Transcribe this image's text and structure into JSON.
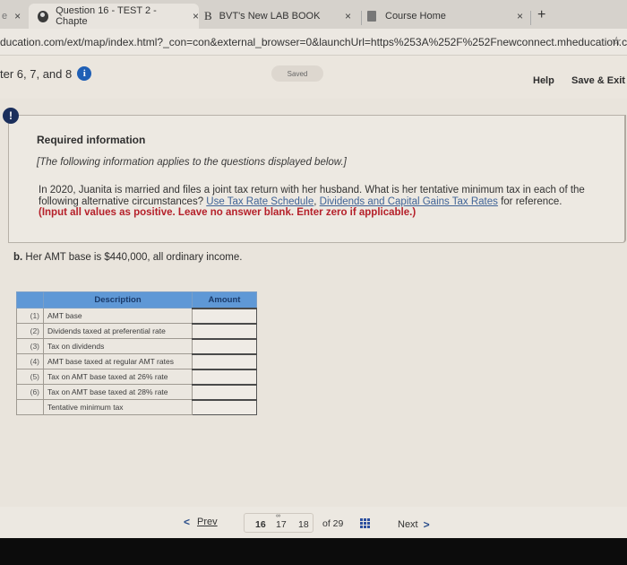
{
  "browser": {
    "tabs": [
      {
        "label": "e",
        "active": false
      },
      {
        "label": "Question 16 - TEST 2 - Chapte",
        "active": true
      },
      {
        "label": "BVT's New LAB BOOK",
        "icon_letter": "B",
        "active": false
      },
      {
        "label": "Course Home",
        "active": false
      }
    ],
    "new_tab": "+",
    "close_glyph": "×",
    "url": "ducation.com/ext/map/index.html?_con=con&external_browser=0&launchUrl=https%253A%252F%252Fnewconnect.mheducation.co...",
    "star": "☆"
  },
  "header": {
    "chapter": "ter 6, 7, and 8",
    "info_glyph": "i",
    "saved": "Saved",
    "help": "Help",
    "save_exit": "Save & Exit"
  },
  "info": {
    "alert_glyph": "!",
    "title": "Required information",
    "subtitle": "[The following information applies to the questions displayed below.]",
    "body_1": "In 2020, Juanita is married and files a joint tax return with her husband. What is her tentative minimum tax in each of the following alternative circumstances? ",
    "link_1": "Use Tax Rate Schedule",
    "sep": ", ",
    "link_2": "Dividends and Capital Gains Tax Rates",
    "body_2": " for reference.",
    "note": "(Input all values as positive. Leave no answer blank. Enter zero if applicable.)"
  },
  "question": {
    "label": "b.",
    "text": " Her AMT base is $440,000, all ordinary income."
  },
  "table": {
    "headers": [
      "",
      "Description",
      "Amount"
    ],
    "rows": [
      {
        "num": "(1)",
        "desc": "AMT base",
        "amount": ""
      },
      {
        "num": "(2)",
        "desc": "Dividends taxed at preferential rate",
        "amount": ""
      },
      {
        "num": "(3)",
        "desc": "Tax on dividends",
        "amount": ""
      },
      {
        "num": "(4)",
        "desc": "AMT base taxed at regular AMT rates",
        "amount": ""
      },
      {
        "num": "(5)",
        "desc": "Tax on AMT base taxed at 26% rate",
        "amount": ""
      },
      {
        "num": "(6)",
        "desc": "Tax on AMT base taxed at 28% rate",
        "amount": ""
      },
      {
        "num": "",
        "desc": "Tentative minimum tax",
        "amount": ""
      }
    ]
  },
  "pager": {
    "prev": "Prev",
    "prev_glyph": "<",
    "pages": [
      "16",
      "17",
      "18"
    ],
    "current": "16",
    "link_glyph": "∞",
    "of": "of 29",
    "next": "Next",
    "next_glyph": ">"
  }
}
